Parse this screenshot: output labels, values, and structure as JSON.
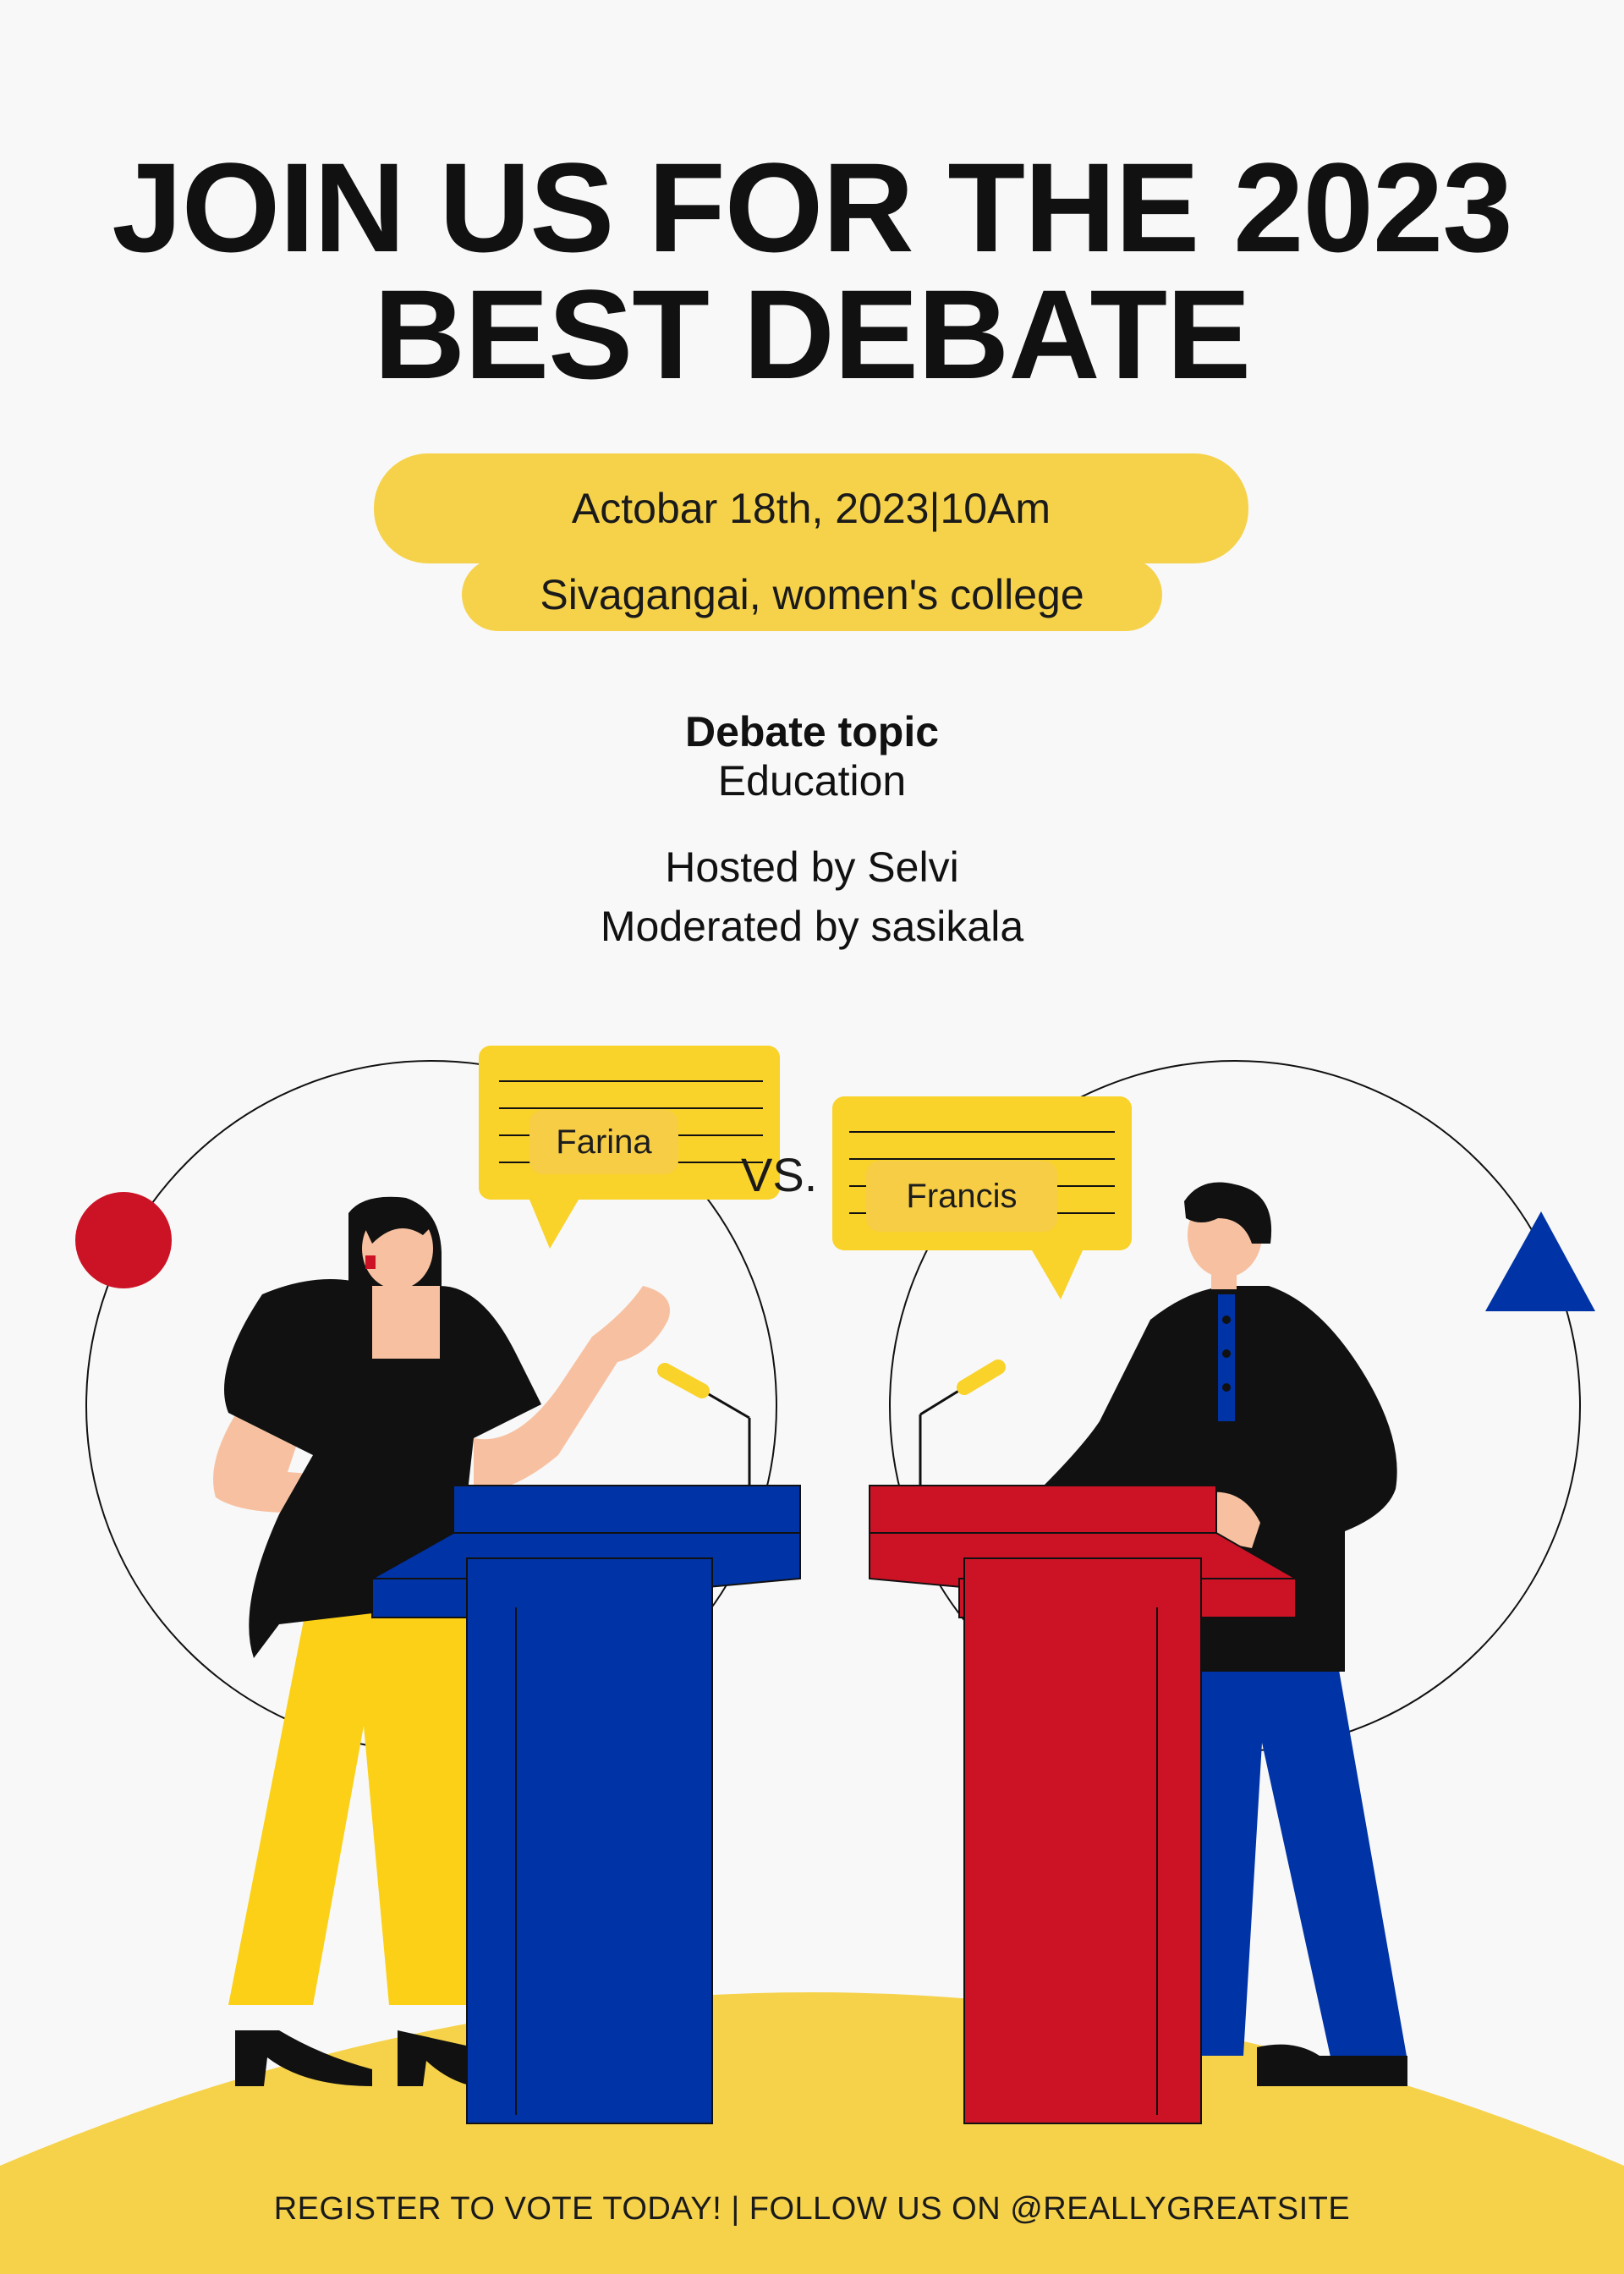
{
  "poster": {
    "title_line1": "JOIN US FOR THE 2023",
    "title_line2": "BEST DEBATE",
    "date_time": "Actobar 18th, 2023|10Am",
    "venue": "Sivagangai, women's college",
    "topic_heading": "Debate topic",
    "topic_value": "Education",
    "host": "Hosted by Selvi",
    "moderator": "Moderated by sasikala",
    "speaker_left": "Farina",
    "speaker_right": "Francis",
    "versus": "VS.",
    "footer": "REGISTER TO VOTE TODAY! | FOLLOW US ON @REALLYGREATSITE"
  },
  "colors": {
    "background": "#f8f8f8",
    "yellow": "#f6d24a",
    "red": "#cc1326",
    "blue": "#0033a6",
    "black": "#111111",
    "skin": "#f7c1a1"
  },
  "icons": [
    "red-circle-decoration",
    "blue-triangle-decoration",
    "speech-bubble-icon",
    "microphone-icon"
  ]
}
